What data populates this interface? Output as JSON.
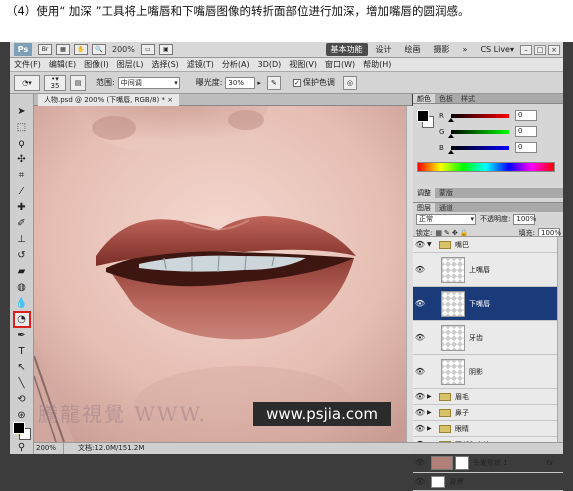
{
  "caption": {
    "text": "（4）使用“ 加深 ”工具将上嘴唇和下嘴唇图像的转折面部位进行加深，增加嘴唇的圆润感。"
  },
  "topbar": {
    "logo": "Ps",
    "zoom": "200%",
    "workspaces": [
      "基本功能",
      "设计",
      "绘画",
      "摄影"
    ],
    "more": "»",
    "cs_live": "CS Live▾"
  },
  "menu": [
    "文件(F)",
    "编辑(E)",
    "图像(I)",
    "图层(L)",
    "选择(S)",
    "滤镜(T)",
    "分析(A)",
    "3D(D)",
    "视图(V)",
    "窗口(W)",
    "帮助(H)"
  ],
  "options": {
    "brush_size": "35",
    "range_label": "范围:",
    "range_value": "中间调",
    "exposure_label": "曝光度:",
    "exposure_value": "30%",
    "protect_label": "保护色调",
    "protect_checked": "✓"
  },
  "document": {
    "tab_title": "人物.psd @ 200% (下嘴唇, RGB/8) *",
    "close": "×",
    "status_zoom": "200%",
    "status_doc": "文档:12.0M/151.2M"
  },
  "watermark": {
    "site": "www.psjia.com",
    "brand": "騰龍視覺 WWW."
  },
  "color_panel": {
    "tabs": [
      "颜色",
      "色板",
      "样式"
    ],
    "channels": [
      {
        "label": "R",
        "value": "0"
      },
      {
        "label": "G",
        "value": "0"
      },
      {
        "label": "B",
        "value": "0"
      }
    ]
  },
  "adjust_tabs": [
    "调整",
    "蒙版"
  ],
  "layers_panel": {
    "tabs": [
      "图层",
      "通道"
    ],
    "blend_mode": "正常",
    "opacity_label": "不透明度:",
    "opacity": "100%",
    "lock_label": "锁定:",
    "fill_label": "填充:",
    "fill": "100%",
    "layers": [
      {
        "name": "嘴巴",
        "type": "group-open"
      },
      {
        "name": "上嘴唇",
        "type": "layer"
      },
      {
        "name": "下嘴唇",
        "type": "layer",
        "selected": true
      },
      {
        "name": "牙齿",
        "type": "layer"
      },
      {
        "name": "阴影",
        "type": "layer"
      },
      {
        "name": "眉毛",
        "type": "group"
      },
      {
        "name": "鼻子",
        "type": "group"
      },
      {
        "name": "眼睛",
        "type": "group"
      },
      {
        "name": "面部和身体",
        "type": "group"
      },
      {
        "name": "头发形状 1",
        "type": "shape",
        "fx": "fx"
      },
      {
        "name": "背景",
        "type": "background"
      }
    ]
  }
}
